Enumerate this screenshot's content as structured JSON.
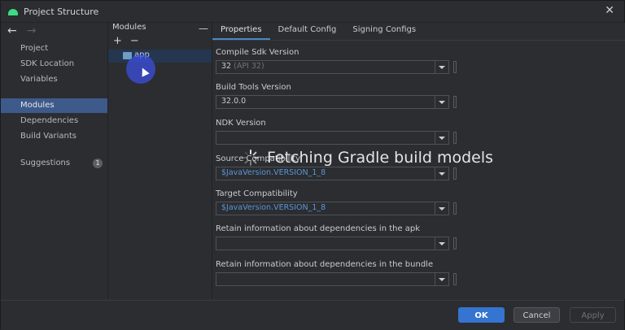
{
  "window": {
    "title": "Project Structure"
  },
  "sidebar": {
    "items": [
      {
        "label": "Project"
      },
      {
        "label": "SDK Location"
      },
      {
        "label": "Variables"
      },
      {
        "label": "Modules",
        "selected": true
      },
      {
        "label": "Dependencies"
      },
      {
        "label": "Build Variants"
      },
      {
        "label": "Suggestions",
        "badge": "1"
      }
    ]
  },
  "modules_panel": {
    "header": "Modules",
    "add": "+",
    "remove": "−",
    "collapse": "—",
    "items": [
      {
        "name": "app"
      }
    ]
  },
  "tabs": [
    {
      "label": "Properties",
      "active": true
    },
    {
      "label": "Default Config"
    },
    {
      "label": "Signing Configs"
    }
  ],
  "fields": [
    {
      "label": "Compile Sdk Version",
      "value": "32",
      "hint": "(API 32)"
    },
    {
      "label": "Build Tools Version",
      "value": "32.0.0"
    },
    {
      "label": "NDK Version",
      "value": ""
    },
    {
      "label": "Source Compatibility",
      "value": "$JavaVersion.VERSION_1_8"
    },
    {
      "label": "Target Compatibility",
      "value": "$JavaVersion.VERSION_1_8"
    },
    {
      "label": "Retain information about dependencies in the apk",
      "value": ""
    },
    {
      "label": "Retain information about dependencies in the bundle",
      "value": ""
    }
  ],
  "overlay": {
    "message": "Fetching Gradle build models"
  },
  "buttons": {
    "ok": "OK",
    "cancel": "Cancel",
    "apply": "Apply"
  },
  "colors": {
    "accent": "#3574d0",
    "selection": "#3d5a8a",
    "link": "#5b95d8",
    "background": "#2b2d30"
  }
}
